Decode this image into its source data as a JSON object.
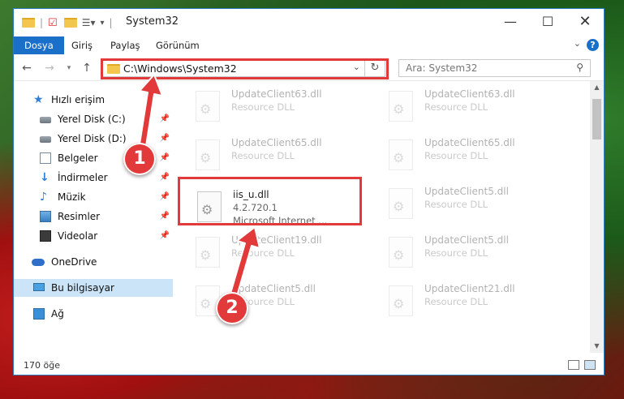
{
  "window": {
    "title": "System32"
  },
  "ribbon": {
    "tabs": [
      "Dosya",
      "Giriş",
      "Paylaş",
      "Görünüm"
    ],
    "help": "?"
  },
  "address": {
    "path": "C:\\Windows\\System32"
  },
  "search": {
    "placeholder": "Ara: System32"
  },
  "sidebar": {
    "items": [
      {
        "label": "Hızlı erişim",
        "icon": "star-icon"
      },
      {
        "label": "Yerel Disk (C:)",
        "icon": "drive-icon",
        "pinned": true
      },
      {
        "label": "Yerel Disk (D:)",
        "icon": "drive-icon",
        "pinned": true
      },
      {
        "label": "Belgeler",
        "icon": "document-icon",
        "pinned": true
      },
      {
        "label": "İndirmeler",
        "icon": "download-icon",
        "pinned": true
      },
      {
        "label": "Müzik",
        "icon": "music-icon",
        "pinned": true
      },
      {
        "label": "Resimler",
        "icon": "pictures-icon",
        "pinned": true
      },
      {
        "label": "Videolar",
        "icon": "videos-icon",
        "pinned": true
      },
      {
        "label": "OneDrive",
        "icon": "cloud-icon"
      },
      {
        "label": "Bu bilgisayar",
        "icon": "computer-icon",
        "selected": true
      },
      {
        "label": "Ağ",
        "icon": "network-icon"
      }
    ]
  },
  "files": [
    {
      "name": "UpdateClient63.dll",
      "desc": "Resource DLL",
      "faded": true
    },
    {
      "name": "UpdateClient65.dll",
      "desc": "Resource DLL",
      "faded": true
    },
    {
      "name": "UpdateClient65.dll",
      "desc": "Resource DLL",
      "faded": true
    },
    {
      "name": "UpdateClient63.dll",
      "desc": "Resource DLL",
      "faded": true
    },
    {
      "name": "iis_u.dll",
      "desc": "4.2.720.1",
      "desc2": "Microsoft Internet ...",
      "faded": false
    },
    {
      "name": "UpdateClient5.dll",
      "desc": "Resource DLL",
      "faded": true
    },
    {
      "name": "UpdateClient19.dll",
      "desc": "Resource DLL",
      "faded": true
    },
    {
      "name": "UpdateClient5.dll",
      "desc": "Resource DLL",
      "faded": true
    },
    {
      "name": "UpdateClient5.dll",
      "desc": "Resource DLL",
      "faded": true
    },
    {
      "name": "UpdateClient21.dll",
      "desc": "Resource DLL",
      "faded": true
    }
  ],
  "status": {
    "count": "170 öğe"
  },
  "annotations": {
    "badge1": "1",
    "badge2": "2",
    "color": "#e23a3a"
  }
}
